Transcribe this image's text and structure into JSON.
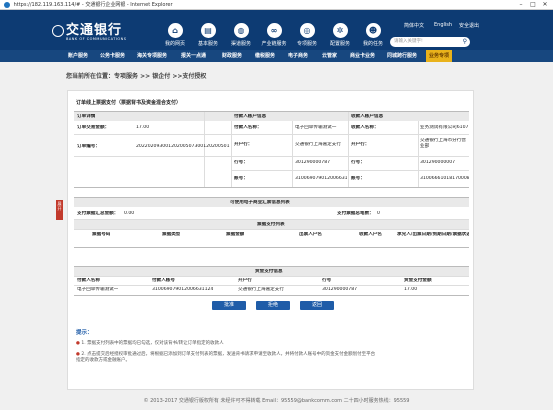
{
  "window": {
    "title": "https://182.119.163.114/# - 交通银行企业网银 - Internet Explorer"
  },
  "header": {
    "logo_cn": "交通银行",
    "logo_en": "BANK OF COMMUNICATIONS",
    "nav": [
      {
        "label": "我的网页",
        "icon": "home-icon"
      },
      {
        "label": "基本服务",
        "icon": "document-icon"
      },
      {
        "label": "渠道服务",
        "icon": "globe-icon"
      },
      {
        "label": "产业链服务",
        "icon": "link-icon"
      },
      {
        "label": "专项服务",
        "icon": "target-icon"
      },
      {
        "label": "配置服务",
        "icon": "gear-icon"
      },
      {
        "label": "我的任务",
        "icon": "user-icon"
      }
    ],
    "lang_simplified": "简体中文",
    "lang_english": "English",
    "logout": "安全退出",
    "search_placeholder": "请输入关键字!"
  },
  "menu": [
    "账户服务",
    "公务卡服务",
    "海关专项服务",
    "报关一点通",
    "财政服务",
    "缴税服务",
    "电子商务",
    "云管家",
    "商业卡业务",
    "同城跨行服务",
    "业务专项"
  ],
  "breadcrumb": "您当前所在位置：专项服务 >> 银企付 >>支付授权",
  "order": {
    "section_title": "订单线上票据支付（票据背书及资金混合支付）",
    "col1_header": "订单详情",
    "col2_header": "付款人账户信息",
    "col3_header": "收款人账户信息",
    "amount_label": "订单交易金额：",
    "amount_value": "17.00",
    "order_no_label": "订单编号：",
    "order_no_value": "20220209300120200507300120200501",
    "payer_name_label": "付款人名称：",
    "payer_name_value": "电子回单传输测试一",
    "payer_bank_label": "开户行：",
    "payer_bank_value": "交通银行上海嘉定支行",
    "payer_bankno_label": "行号：",
    "payer_bankno_value": "301290000787",
    "payer_acct_label": "账号：",
    "payer_acct_value": "310069079012006631124",
    "payee_name_label": "收款人名称：",
    "payee_name_value": "业务测试有限公司6107",
    "payee_bank_label": "开户行：",
    "payee_bank_value": "交通银行上海市分行营业部",
    "payee_bankno_label": "行号：",
    "payee_bankno_value": "301290000007",
    "payee_acct_label": "账号：",
    "payee_acct_value": "310066610181700082259"
  },
  "bills": {
    "section_title": "可使用电子商业汇票信息列表",
    "total_amount_label": "支付票据汇总金额：",
    "total_amount_value": "0.00",
    "total_count_label": "支付票据总笔数：",
    "total_count_value": "0",
    "list_title": "票据支付列表",
    "columns": [
      "票据号码",
      "票据类型",
      "票据金额",
      "出票人户名",
      "收款人户名",
      "承兑人/出票日期/到期日期/票据状态"
    ]
  },
  "funds": {
    "section_title": "资金支付信息",
    "columns": [
      "付款人名称",
      "付款人账号",
      "开户行",
      "行号",
      "资金支付金额"
    ],
    "rows": [
      [
        "电子回单传输测试一",
        "310069079012006631124",
        "交通银行上海嘉定支行",
        "301290000787",
        "17.00"
      ]
    ]
  },
  "buttons": {
    "approve": "批准",
    "reject": "拒绝",
    "back": "返回"
  },
  "tips": {
    "title": "提示：",
    "items": [
      "1. 票据支付列表中的票据均已勾选，仅对该背书/转让订单指定的收款人",
      "2. 点击提交后经授权审批通过后，将根据已添加到订单支付列表的票据，发送背书请求申请至收款人，并将付款人账号中的资金支付金额划付至平台指定的收款方或金融账户。"
    ]
  },
  "side_tab": "展开",
  "footer": "© 2013-2017 交通银行版权所有 未经许可不得转载 Email：95559@bankcomm.com 二十四小时服务热线：95559"
}
